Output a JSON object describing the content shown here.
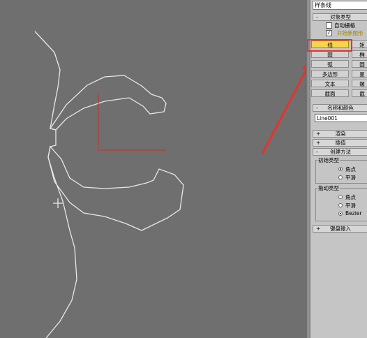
{
  "panel": {
    "top_field": "样条线",
    "object_type": {
      "sign": "-",
      "title": "对象类型"
    },
    "auto_grid": {
      "label": "自动栅格"
    },
    "start_new_shape": {
      "label": "开始新图形",
      "checked": true
    },
    "buttons": [
      {
        "label": "线",
        "state": "active"
      },
      {
        "label": "矩"
      },
      {
        "label": "圆"
      },
      {
        "label": "椭"
      },
      {
        "label": "弧"
      },
      {
        "label": "圆"
      },
      {
        "label": "多边形"
      },
      {
        "label": "星"
      },
      {
        "label": "文本"
      },
      {
        "label": "螺"
      },
      {
        "label": "截面"
      },
      {
        "label": "截"
      }
    ],
    "name_color": {
      "sign": "-",
      "title": "名称和颜色",
      "name_value": "Line001"
    },
    "rendering": {
      "sign": "+",
      "title": "渲染"
    },
    "interpolation": {
      "sign": "+",
      "title": "插值"
    },
    "creation_method": {
      "sign": "-",
      "title": "创建方法",
      "initial_type": {
        "title": "初始类型",
        "options": [
          "角点",
          "平滑"
        ],
        "selected": 0
      },
      "drag_type": {
        "title": "拖动类型",
        "options": [
          "角点",
          "平滑",
          "Bezier"
        ],
        "selected": 2
      }
    },
    "keyboard_input": {
      "sign": "+",
      "title": "键盘输入"
    }
  },
  "colors": {
    "viewport_bg": "#6f6f6f",
    "spline": "#e8e8e8",
    "axis": "#c0302b",
    "highlight": "#e8322c",
    "active_button": "#f5d54d"
  }
}
